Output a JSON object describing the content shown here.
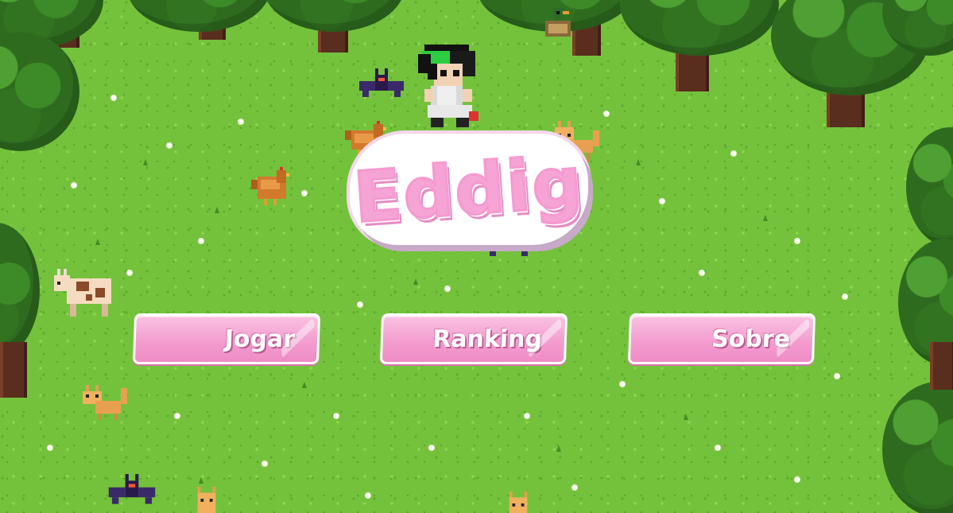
{
  "game": {
    "title": "Eddig"
  },
  "menu": {
    "play_label": "Jogar",
    "ranking_label": "Ranking",
    "about_label": "Sobre"
  },
  "colors": {
    "grass": "#74c23c",
    "tree_canopy": "#2e6b1f",
    "tree_trunk": "#5a2e1e",
    "button_pink": "#f39bcf",
    "logo_pink": "#f6a3d6"
  },
  "icons": [
    "player-character-icon",
    "bat-icon",
    "chicken-icon",
    "cat-icon",
    "cow-icon",
    "duck-icon",
    "tree-icon"
  ]
}
